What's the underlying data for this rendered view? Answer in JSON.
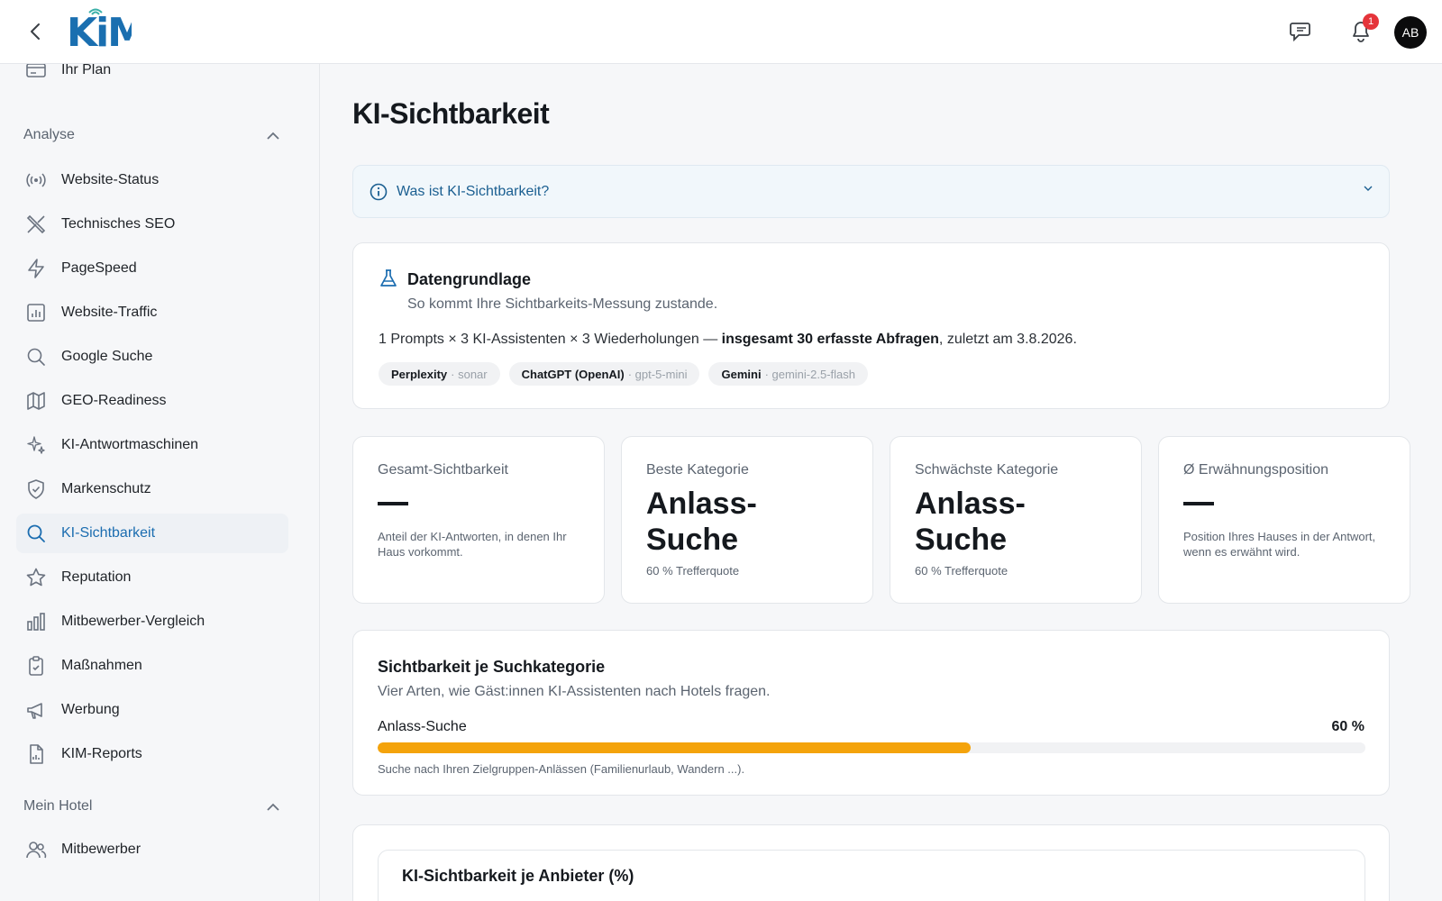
{
  "app": {
    "logo_text": "KiM"
  },
  "header": {
    "notifications_count": "1",
    "avatar_initials": "AB"
  },
  "sidebar": {
    "top_item": {
      "label": "Ihr Plan",
      "icon": "credit-card-icon"
    },
    "section_analyse": "Analyse",
    "items": [
      {
        "label": "Website-Status",
        "icon": "broadcast-icon"
      },
      {
        "label": "Technisches SEO",
        "icon": "tools-icon"
      },
      {
        "label": "PageSpeed",
        "icon": "lightning-icon"
      },
      {
        "label": "Website-Traffic",
        "icon": "chart-box-icon"
      },
      {
        "label": "Google Suche",
        "icon": "search-icon"
      },
      {
        "label": "GEO-Readiness",
        "icon": "map-icon"
      },
      {
        "label": "KI-Antwortmaschinen",
        "icon": "sparkles-icon"
      },
      {
        "label": "Markenschutz",
        "icon": "shield-check-icon"
      },
      {
        "label": "KI-Sichtbarkeit",
        "icon": "search-icon",
        "active": true
      },
      {
        "label": "Reputation",
        "icon": "star-icon"
      },
      {
        "label": "Mitbewerber-Vergleich",
        "icon": "bar-chart-icon"
      },
      {
        "label": "Maßnahmen",
        "icon": "clipboard-check-icon"
      },
      {
        "label": "Werbung",
        "icon": "megaphone-icon"
      },
      {
        "label": "KIM-Reports",
        "icon": "report-file-icon"
      }
    ],
    "section_hotel": "Mein Hotel",
    "hotel_items": [
      {
        "label": "Mitbewerber",
        "icon": "users-icon"
      }
    ]
  },
  "main": {
    "title": "KI-Sichtbarkeit",
    "info_label": "Was ist KI-Sichtbarkeit?",
    "data_basis": {
      "title": "Datengrundlage",
      "subtitle": "So kommt Ihre Sichtbarkeits-Messung zustande.",
      "line_prefix": "1 Prompts × 3 KI-Assistenten × 3 Wiederholungen — ",
      "line_bold": "insgesamt 30 erfasste Abfragen",
      "line_suffix": ", zuletzt am 3.8.2026.",
      "chips": [
        {
          "name": "Perplexity",
          "model": "· sonar"
        },
        {
          "name": "ChatGPT (OpenAI)",
          "model": "· gpt-5-mini"
        },
        {
          "name": "Gemini",
          "model": "· gemini-2.5-flash"
        }
      ]
    },
    "kpis": [
      {
        "label": "Gesamt-Sichtbarkeit",
        "desc": "Anteil der KI-Antworten, in denen Ihr Haus vorkommt."
      },
      {
        "label": "Beste Kategorie",
        "value": "Anlass-Suche",
        "pct": "60 % Trefferquote"
      },
      {
        "label": "Schwächste Kategorie",
        "value": "Anlass-Suche",
        "pct": "60 % Trefferquote"
      },
      {
        "label": "Ø Erwähnungsposition",
        "desc": "Position Ihres Hauses in der Antwort, wenn es erwähnt wird."
      }
    ],
    "category": {
      "title": "Sichtbarkeit je Suchkategorie",
      "subtitle": "Vier Arten, wie Gäst:innen KI-Assistenten nach Hotels fragen.",
      "rows": [
        {
          "label": "Anlass-Suche",
          "value_text": "60 %",
          "value": 60,
          "hint": "Suche nach Ihren Zielgruppen-Anlässen (Familienurlaub, Wandern ...)."
        }
      ]
    },
    "provider_title": "KI-Sichtbarkeit je Anbieter (%)"
  },
  "colors": {
    "accent": "#1b6db0",
    "bar": "#f4a30b",
    "badge": "#e5343a"
  }
}
